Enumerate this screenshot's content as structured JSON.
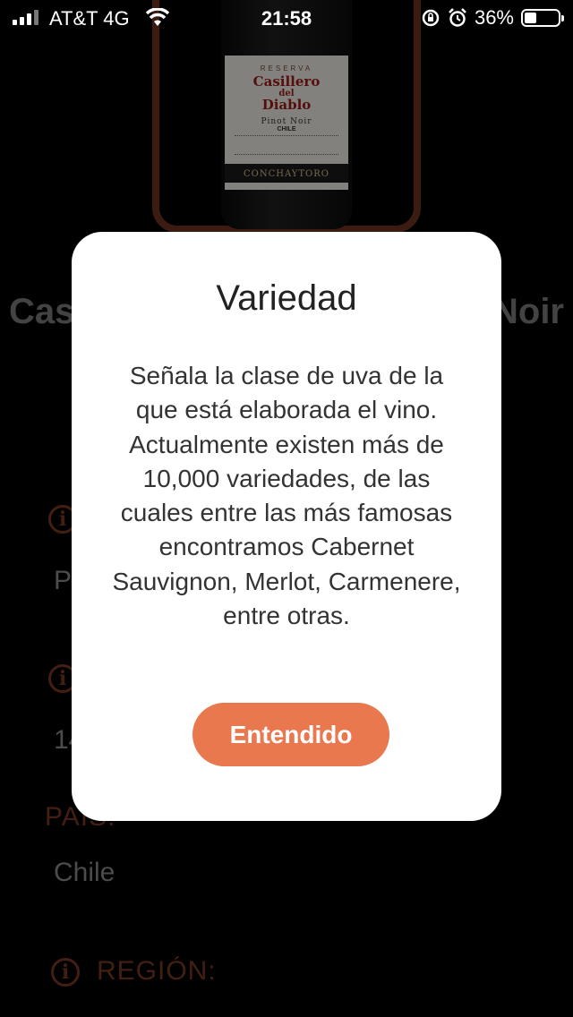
{
  "status_bar": {
    "carrier": "AT&T 4G",
    "time": "21:58",
    "battery": "36%",
    "battery_level": 0.36
  },
  "wine": {
    "title_left": "Cas",
    "title_right": "Noir",
    "label": {
      "reserva": "RESERVA",
      "brand_line1": "Casillero",
      "brand_line2": "del",
      "brand_line3": "Diablo",
      "variety": "Pinot Noir",
      "country": "CHILE",
      "maker": "CONCHAYTORO"
    }
  },
  "background_fields": [
    {
      "value": "P"
    },
    {
      "value": "14"
    },
    {
      "heading": "PAÍS:",
      "value": "Chile"
    },
    {
      "heading": "REGIÓN:"
    }
  ],
  "modal": {
    "title": "Variedad",
    "body": "Señala la clase de uva de la que está elaborada el vino. Actualmente existen más de 10,000 variedades, de las cuales entre las más famosas encontramos Cabernet Sauvignon, Merlot, Carmenere, entre otras.",
    "button": "Entendido"
  }
}
